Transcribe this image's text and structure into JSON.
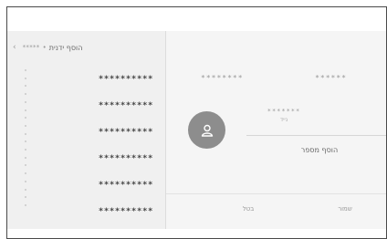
{
  "header": {
    "back_label": "הוסף ידנית",
    "back_stars": "*****",
    "back_separator": "•"
  },
  "list": {
    "items": [
      "**********",
      "**********",
      "**********",
      "**********",
      "**********",
      "**********"
    ]
  },
  "contact": {
    "first_name": "********",
    "last_name": "******",
    "stars": "*******",
    "subtitle": "נייד"
  },
  "actions": {
    "add_number": "הוסף מספר",
    "cancel": "בטל",
    "save": "שמור"
  },
  "icons": {
    "back": "chevron-left-icon",
    "avatar": "person-icon"
  },
  "colors": {
    "avatar_bg": "#8d8d8d",
    "panel_bg": "#f0f0f0"
  }
}
